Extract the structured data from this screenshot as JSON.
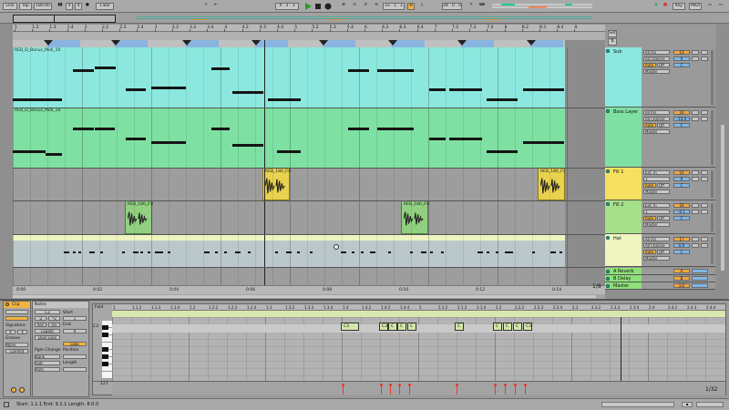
{
  "transport": {
    "link": "Link",
    "tap": "Tap",
    "tempo": "180.00",
    "sig_num": "4",
    "sig_den": "4",
    "quant": "1 Bar",
    "position": "4 . 3 . 3",
    "position2": "33 . 1 . 1",
    "loop_len": "28 . 0 . 0",
    "key": "Key",
    "midi": "MIDI"
  },
  "ruler": {
    "bars": [
      "1",
      "1.2",
      "1.3",
      "1.4",
      "2",
      "2.2",
      "2.3",
      "2.4",
      "3",
      "3.2",
      "3.3",
      "3.4",
      "4",
      "4.2",
      "4.3",
      "4.4",
      "5",
      "5.2",
      "5.3",
      "5.4",
      "6",
      "6.2",
      "6.3",
      "6.4",
      "7",
      "7.2",
      "7.3",
      "7.4",
      "8",
      "8.2",
      "8.3",
      "8.4",
      "9"
    ],
    "times": [
      "0:00",
      "0:02",
      "0:04",
      "0:06",
      "0:08",
      "0:10",
      "0:12",
      "0:14"
    ],
    "zoom": "1/8"
  },
  "tracks": [
    {
      "name": "Sub",
      "clip": "REB_D_Bonus_Midi_10",
      "input": "All Ins",
      "channel": "All Channe",
      "monitor": "Auto",
      "off": "Off",
      "output": "Master",
      "num": "13",
      "vol": "0",
      "pan": "C",
      "color": "#8ce8de"
    },
    {
      "name": "Bass Layer",
      "clip": "REB_D_Bonus_Midi_10",
      "input": "All Ins",
      "channel": "All Channe",
      "monitor": "Auto",
      "off": "Off",
      "output": "Master",
      "num": "14",
      "vol": "-14.0",
      "pan": "C",
      "color": "#7ee0a2"
    },
    {
      "name": "Fill 1",
      "clip": "REB_180_Fill",
      "input": "Ext. In",
      "channel": "1",
      "monitor": "Auto",
      "off": "Off",
      "output": "Master",
      "num": "15",
      "vol": "0",
      "pan": "C",
      "color": "#f6e060"
    },
    {
      "name": "Fill 2",
      "clip": "REB_180_Fill",
      "input": "Ext. In",
      "channel": "1",
      "monitor": "Auto",
      "off": "Off",
      "output": "Master",
      "num": "16",
      "vol": "-0.1",
      "pan": "C",
      "color": "#a6e08a"
    },
    {
      "name": "Hat",
      "clip": "",
      "input": "All Ins",
      "channel": "All Channe",
      "monitor": "Auto",
      "off": "Off",
      "output": "Master",
      "num": "17",
      "vol": "0.9",
      "pan": "C",
      "color": "#eef5c0"
    }
  ],
  "returns": [
    {
      "name": "A Reverb",
      "letter": "A",
      "color": "#8ee07a"
    },
    {
      "name": "B Delay",
      "letter": "B",
      "color": "#8ee07a"
    },
    {
      "name": "Master",
      "letter": "1/2",
      "color": "#8ee07a"
    }
  ],
  "clip_panel": {
    "clip_title": "Clip",
    "notes_title": "Notes",
    "signature": "Signature",
    "sig_num": "4",
    "sig_den": "4",
    "groove": "Groove",
    "groove_val": "None",
    "start": "Start",
    "end": "End",
    "loop": "Loop",
    "position": "Position",
    "length": "Length",
    "start_val": "1",
    "end_val": "9",
    "bank": "Bank",
    "sub": "Sub",
    "pgm": "Pgm",
    "pgm_change": "Pgm Change",
    "dupl_loop": "Dupl.Loop",
    "rev": "Rev",
    "inv": "Inv",
    "legato": "Legato",
    "half": ":2",
    "double": "*2",
    "commit": "Commit"
  },
  "piano_roll": {
    "fold": "Fold",
    "ruler": [
      "1",
      "1.1.2",
      "1.1.3",
      "1.1.4",
      "1.2",
      "1.2.2",
      "1.2.3",
      "1.2.4",
      "1.3",
      "1.3.2",
      "1.3.3",
      "1.3.4",
      "1.4",
      "1.4.2",
      "1.4.3",
      "1.4.4",
      "2",
      "2.1.2",
      "2.1.3",
      "2.1.4",
      "2.2",
      "2.2.2",
      "2.2.3",
      "2.2.4",
      "2.3",
      "2.3.2",
      "2.3.3",
      "2.3.4",
      "2.4",
      "2.4.2",
      "2.4.3",
      "2.4.4"
    ],
    "key_label": "C3",
    "vel_label": "127",
    "notes": [
      "C3",
      "C3",
      "C",
      "C",
      "C",
      "C",
      "C",
      "C",
      "C",
      "C3"
    ],
    "zoom": "1/32"
  },
  "status": {
    "text": "Start: 1.1.1  End: 9.1.1  Length: 8.0.0"
  }
}
